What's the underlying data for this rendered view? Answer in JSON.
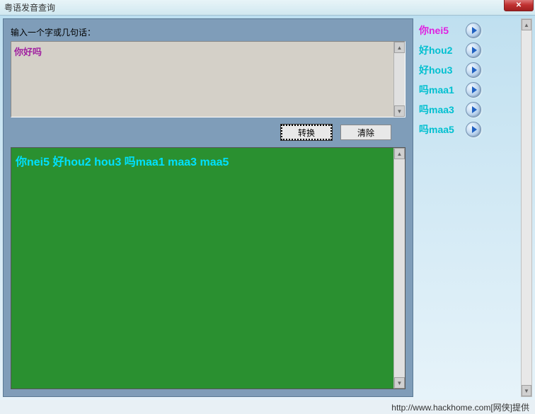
{
  "window": {
    "title": "粤语发音查询"
  },
  "input": {
    "label": "输入一个字或几句话：",
    "value": "你好吗"
  },
  "buttons": {
    "convert": "转换",
    "clear": "清除"
  },
  "output": {
    "text": "你nei5 好hou2 hou3 吗maa1 maa3 maa5"
  },
  "results": [
    {
      "text": "你nei5",
      "color": "magenta"
    },
    {
      "text": "好hou2",
      "color": "cyan"
    },
    {
      "text": "好hou3",
      "color": "cyan"
    },
    {
      "text": "吗maa1",
      "color": "cyan"
    },
    {
      "text": "吗maa3",
      "color": "cyan"
    },
    {
      "text": "吗maa5",
      "color": "cyan"
    }
  ],
  "footer": {
    "text": "http://www.hackhome.com[网侠]提供"
  }
}
